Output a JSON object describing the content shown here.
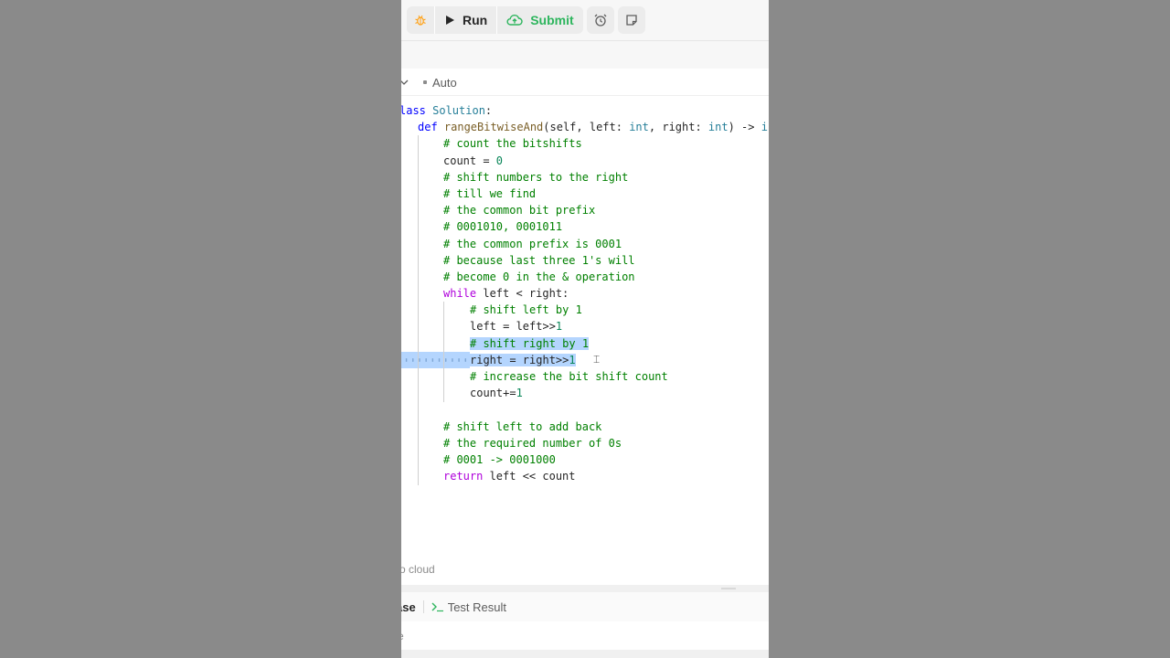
{
  "toolbar": {
    "debug_icon": "bug-icon",
    "run_label": "Run",
    "submit_label": "Submit",
    "alarm_icon": "alarm-clock-icon",
    "note_icon": "note-icon",
    "colors": {
      "debug": "#ffa116",
      "submit": "#2db55d"
    }
  },
  "lang_bar": {
    "mode_label": "Auto"
  },
  "code": {
    "lines": [
      {
        "indent": 0,
        "tokens": [
          {
            "t": "lass ",
            "c": "kw2"
          },
          {
            "t": "Solution",
            "c": "cls"
          },
          {
            "t": ":",
            "c": ""
          }
        ]
      },
      {
        "indent": 1,
        "tokens": [
          {
            "t": "def ",
            "c": "kw2"
          },
          {
            "t": "rangeBitwiseAnd",
            "c": "fn"
          },
          {
            "t": "(self, left: ",
            "c": ""
          },
          {
            "t": "int",
            "c": "cls"
          },
          {
            "t": ", right: ",
            "c": ""
          },
          {
            "t": "int",
            "c": "cls"
          },
          {
            "t": ") -> ",
            "c": ""
          },
          {
            "t": "in",
            "c": "cls"
          }
        ]
      },
      {
        "indent": 2,
        "tokens": [
          {
            "t": "# count the bitshifts",
            "c": "cm"
          }
        ]
      },
      {
        "indent": 2,
        "tokens": [
          {
            "t": "count = ",
            "c": ""
          },
          {
            "t": "0",
            "c": "num"
          }
        ]
      },
      {
        "indent": 2,
        "tokens": [
          {
            "t": "# shift numbers to the right",
            "c": "cm"
          }
        ]
      },
      {
        "indent": 2,
        "tokens": [
          {
            "t": "# till we find",
            "c": "cm"
          }
        ]
      },
      {
        "indent": 2,
        "tokens": [
          {
            "t": "# the common bit prefix",
            "c": "cm"
          }
        ]
      },
      {
        "indent": 2,
        "tokens": [
          {
            "t": "# 0001010, 0001011",
            "c": "cm"
          }
        ]
      },
      {
        "indent": 2,
        "tokens": [
          {
            "t": "# the common prefix is 0001",
            "c": "cm"
          }
        ]
      },
      {
        "indent": 2,
        "tokens": [
          {
            "t": "# because last three 1's will",
            "c": "cm"
          }
        ]
      },
      {
        "indent": 2,
        "tokens": [
          {
            "t": "# become 0 in the & operation",
            "c": "cm"
          }
        ]
      },
      {
        "indent": 2,
        "tokens": [
          {
            "t": "while ",
            "c": "kw"
          },
          {
            "t": "left < right:",
            "c": ""
          }
        ]
      },
      {
        "indent": 3,
        "tokens": [
          {
            "t": "# shift left by 1",
            "c": "cm"
          }
        ]
      },
      {
        "indent": 3,
        "tokens": [
          {
            "t": "left = left>>",
            "c": ""
          },
          {
            "t": "1",
            "c": "num"
          }
        ]
      },
      {
        "indent": 3,
        "selected": true,
        "tokens": [
          {
            "t": "# shift right by 1",
            "c": "cm"
          }
        ]
      },
      {
        "indent": 3,
        "selected": true,
        "tokens": [
          {
            "t": "right = right>>",
            "c": ""
          },
          {
            "t": "1",
            "c": "num"
          }
        ]
      },
      {
        "indent": 3,
        "tokens": [
          {
            "t": "# increase the bit shift count",
            "c": "cm"
          }
        ]
      },
      {
        "indent": 3,
        "tokens": [
          {
            "t": "count+=",
            "c": ""
          },
          {
            "t": "1",
            "c": "num"
          }
        ]
      },
      {
        "indent": 0,
        "tokens": []
      },
      {
        "indent": 2,
        "tokens": [
          {
            "t": "# shift left to add back",
            "c": "cm"
          }
        ]
      },
      {
        "indent": 2,
        "tokens": [
          {
            "t": "# the required number of 0s",
            "c": "cm"
          }
        ]
      },
      {
        "indent": 2,
        "tokens": [
          {
            "t": "# 0001 -> 0001000",
            "c": "cm"
          }
        ]
      },
      {
        "indent": 2,
        "tokens": [
          {
            "t": "return ",
            "c": "kw"
          },
          {
            "t": "left << count",
            "c": ""
          }
        ]
      }
    ]
  },
  "footer": {
    "saved_text": "o cloud",
    "tab_testcase": "ase",
    "tab_result": "Test Result",
    "case_text": "e"
  }
}
